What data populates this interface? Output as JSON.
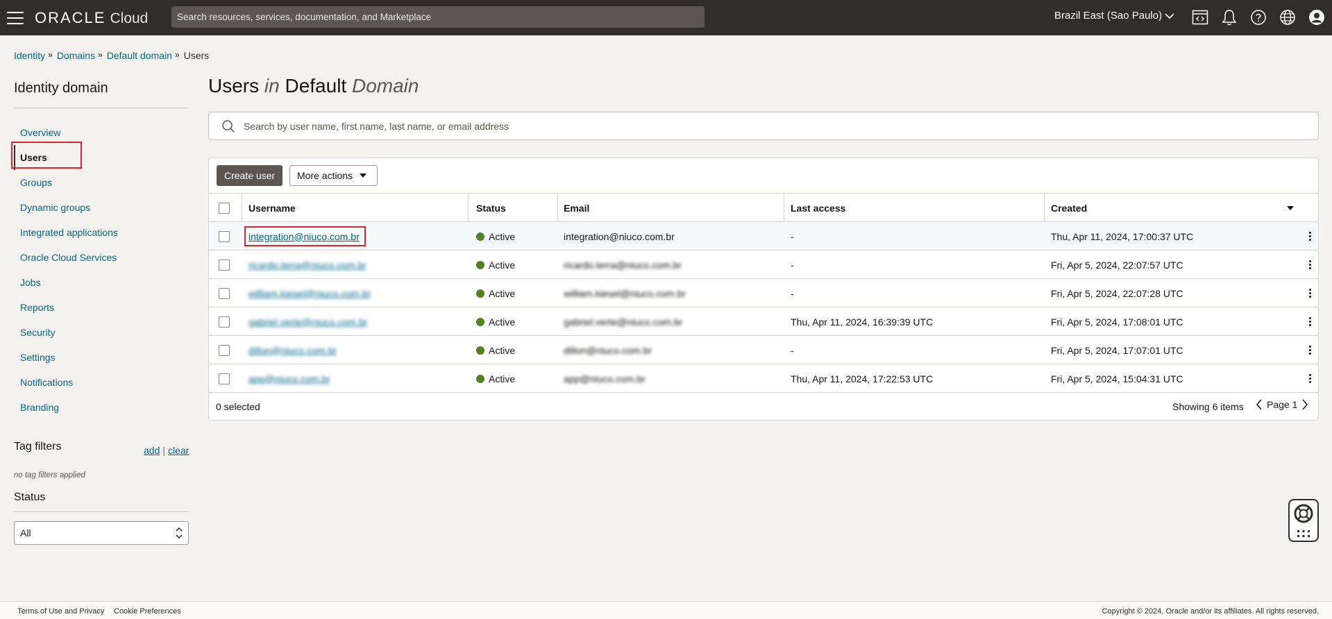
{
  "topbar": {
    "logo_brand": "ORACLE",
    "logo_product": "Cloud",
    "search_placeholder": "Search resources, services, documentation, and Marketplace",
    "region": "Brazil East (Sao Paulo)",
    "icons": [
      "code-editor-icon",
      "bell-icon",
      "help-icon",
      "globe-icon",
      "profile-icon"
    ]
  },
  "breadcrumb": {
    "items": [
      "Identity",
      "Domains",
      "Default domain"
    ],
    "current": "Users",
    "separator": "»"
  },
  "sidebar": {
    "title": "Identity domain",
    "items": [
      {
        "label": "Overview"
      },
      {
        "label": "Users"
      },
      {
        "label": "Groups"
      },
      {
        "label": "Dynamic groups"
      },
      {
        "label": "Integrated applications"
      },
      {
        "label": "Oracle Cloud Services"
      },
      {
        "label": "Jobs"
      },
      {
        "label": "Reports"
      },
      {
        "label": "Security"
      },
      {
        "label": "Settings"
      },
      {
        "label": "Notifications"
      },
      {
        "label": "Branding"
      }
    ],
    "active_index": 1,
    "tag_filters": {
      "title": "Tag filters",
      "add": "add",
      "clear": "clear",
      "empty": "no tag filters applied"
    },
    "status": {
      "title": "Status",
      "selected": "All"
    }
  },
  "main": {
    "title": {
      "word1": "Users",
      "word2": "in",
      "word3": "Default",
      "word4": "Domain"
    },
    "search_placeholder": "Search by user name, first name, last name, or email address",
    "create_button": "Create user",
    "more_actions": "More actions",
    "columns": [
      "Username",
      "Status",
      "Email",
      "Last access",
      "Created"
    ],
    "rows": [
      {
        "username": "integration@niuco.com.br",
        "status": "Active",
        "email": "integration@niuco.com.br",
        "last_access": "-",
        "created": "Thu, Apr 11, 2024, 17:00:37 UTC",
        "blurred": false
      },
      {
        "username": "ricardo.terra@niuco.com.br",
        "status": "Active",
        "email": "ricardo.terra@niuco.com.br",
        "last_access": "-",
        "created": "Fri, Apr 5, 2024, 22:07:57 UTC",
        "blurred": true
      },
      {
        "username": "william.kiesel@niuco.com.br",
        "status": "Active",
        "email": "william.kiesel@niuco.com.br",
        "last_access": "-",
        "created": "Fri, Apr 5, 2024, 22:07:28 UTC",
        "blurred": true
      },
      {
        "username": "gabriel.verte@niuco.com.br",
        "status": "Active",
        "email": "gabriel.verte@niuco.com.br",
        "last_access": "Thu, Apr 11, 2024, 16:39:39 UTC",
        "created": "Fri, Apr 5, 2024, 17:08:01 UTC",
        "blurred": true
      },
      {
        "username": "dillon@niuco.com.br",
        "status": "Active",
        "email": "dillon@niuco.com.br",
        "last_access": "-",
        "created": "Fri, Apr 5, 2024, 17:07:01 UTC",
        "blurred": true
      },
      {
        "username": "app@niuco.com.br",
        "status": "Active",
        "email": "app@niuco.com.br",
        "last_access": "Thu, Apr 11, 2024, 17:22:53 UTC",
        "created": "Fri, Apr 5, 2024, 15:04:31 UTC",
        "blurred": true
      }
    ],
    "selected_text": "0 selected",
    "showing_text": "Showing 6 items",
    "page_text": "Page 1",
    "status_color": "#508223"
  },
  "footer": {
    "terms": "Terms of Use and Privacy",
    "cookies": "Cookie Preferences",
    "copyright": "Copyright © 2024, Oracle and/or its affiliates. All rights reserved."
  },
  "colors": {
    "topbar": "#312d2a",
    "link": "#00688c",
    "highlight": "#d9262b",
    "primary_button": "#5b5652"
  }
}
